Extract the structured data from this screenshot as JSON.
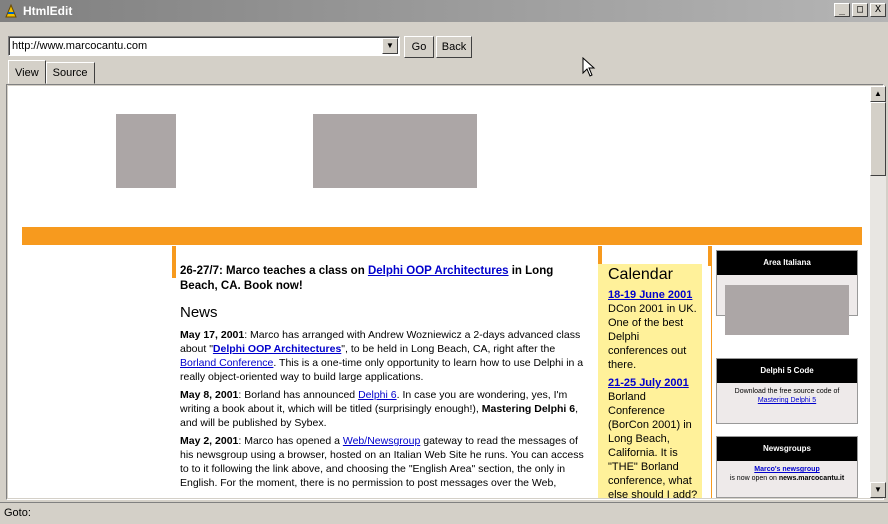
{
  "window": {
    "title": "HtmlEdit",
    "buttons": {
      "minimize": "_",
      "maximize": "□",
      "close": "X"
    }
  },
  "address": {
    "url": "http://www.marcocantu.com",
    "go_label": "Go",
    "back_label": "Back"
  },
  "tabs": [
    {
      "label": "View"
    },
    {
      "label": "Source"
    }
  ],
  "status": {
    "label": "Goto:"
  },
  "page": {
    "headline": {
      "pre": "26-27/7: Marco teaches a class on ",
      "link": "Delphi OOP Architectures",
      "post": " in Long Beach, CA. Book now!"
    },
    "news_heading": "News",
    "items": [
      {
        "date": "May 17, 2001",
        "t1": ": Marco has arranged with Andrew Wozniewicz a 2-days advanced class about \"",
        "link1": "Delphi OOP Architectures",
        "t2": "\", to be held in Long Beach, CA, right after the ",
        "link2": "Borland Conference",
        "t3": ". This is a one-time only opportunity to learn how to use Delphi in a really object-oriented way to build large applications."
      },
      {
        "date": "May 8, 2001",
        "t1": ": Borland has announced ",
        "link1": "Delphi 6",
        "t2": ". In case you are wondering, yes, I'm writing a book about it, which will be titled (surprisingly enough!), ",
        "bold": "Mastering Delphi 6",
        "t3": ", and will be published by Sybex."
      },
      {
        "date": "May 2, 2001",
        "t1": ": Marco has opened a ",
        "link1": "Web/Newsgroup",
        "t2": " gateway to read the messages of his newsgroup using a browser, hosted on an Italian Web Site he runs. You can access to to it following the link above, and choosing the \"English Area\" section, the only in English. For the moment, there is no permission to post messages over the Web,"
      }
    ],
    "calendar": {
      "heading": "Calendar",
      "events": [
        {
          "date": "18-19 June 2001",
          "text": "DCon 2001 in UK. One of the best Delphi conferences out there."
        },
        {
          "date": "21-25 July 2001",
          "text": "Borland Conference (BorCon 2001) in Long Beach, California. It is \"THE\" Borland conference, what else should I add?"
        }
      ]
    },
    "sidebar": [
      {
        "title": "Area Italiana"
      },
      {
        "title": "Delphi 5 Code",
        "text": "Download the free source code of",
        "link": "Mastering Delphi 5"
      },
      {
        "title": "Newsgroups",
        "link": "Marco's newsgroup",
        "text": "is now open on ",
        "bold": "news.marcocantu.it"
      }
    ]
  },
  "colors": {
    "accent": "#f79a1e",
    "calendar_bg": "#fff19a",
    "placeholder": "#aca6a6",
    "titlebar": "#808080"
  },
  "icons": {
    "app": "app-icon",
    "cursor": "mouse-pointer-icon"
  }
}
